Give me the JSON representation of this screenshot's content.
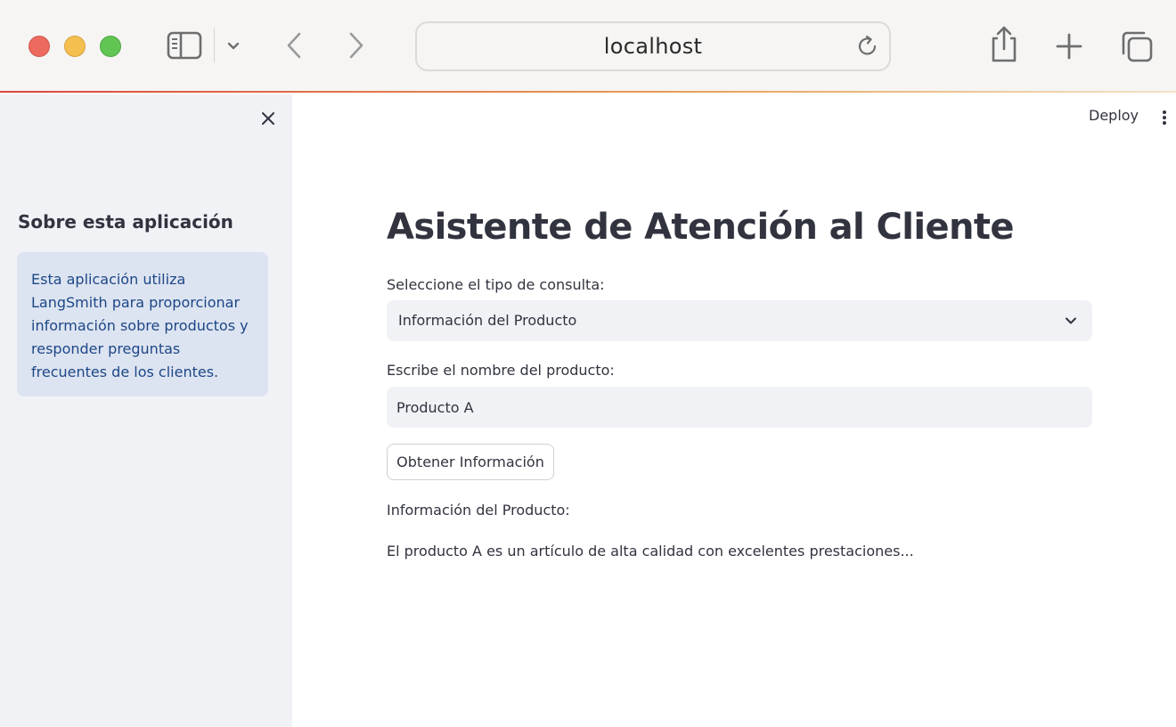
{
  "browser": {
    "url": "localhost"
  },
  "sidebar": {
    "heading": "Sobre esta aplicación",
    "info_text": "Esta aplicación utiliza LangSmith para proporcionar información sobre productos y responder preguntas frecuentes de los clientes."
  },
  "header": {
    "deploy_label": "Deploy"
  },
  "main": {
    "title": "Asistente de Atención al Cliente",
    "query_type_label": "Seleccione el tipo de consulta:",
    "query_type_value": "Información del Producto",
    "product_name_label": "Escribe el nombre del producto:",
    "product_name_value": "Producto A",
    "submit_label": "Obtener Información",
    "result_heading": "Información del Producto:",
    "result_text": "El producto A es un artículo de alta calidad con excelentes prestaciones..."
  },
  "colors": {
    "sidebar_bg": "#f0f2f6",
    "info_box_bg": "#dde4f1",
    "info_text": "#1c4787",
    "text": "#31333f"
  }
}
